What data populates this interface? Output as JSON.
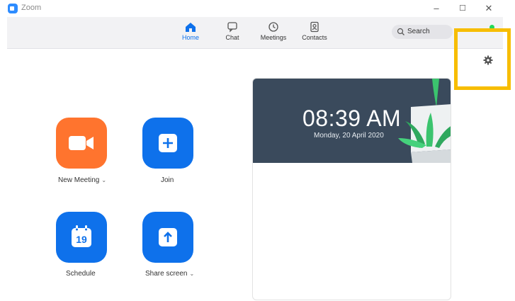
{
  "window": {
    "title": "Zoom",
    "minimize": "–",
    "maximize": "☐",
    "close": "✕"
  },
  "nav": {
    "items": [
      {
        "label": "Home",
        "icon": "home-icon",
        "active": true
      },
      {
        "label": "Chat",
        "icon": "chat-icon"
      },
      {
        "label": "Meetings",
        "icon": "clock-icon"
      },
      {
        "label": "Contacts",
        "icon": "contacts-icon"
      }
    ],
    "search_label": "Search"
  },
  "actions": {
    "new_meeting": "New Meeting",
    "join": "Join",
    "schedule": "Schedule",
    "schedule_day": "19",
    "share_screen": "Share screen",
    "chevron": "⌄"
  },
  "clock": {
    "time": "08:39 AM",
    "date": "Monday, 20 April 2020"
  },
  "colors": {
    "accent": "#0e71eb",
    "orange": "#ff742e",
    "highlight": "#f7bd00",
    "status": "#23d959"
  }
}
